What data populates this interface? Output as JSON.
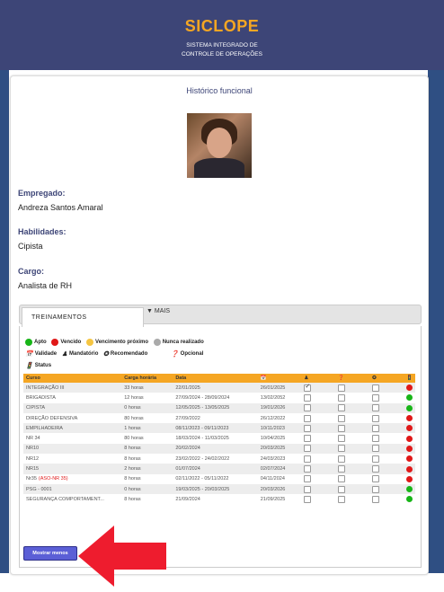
{
  "header": {
    "brand": "SICLOPE",
    "subtitle_line1": "SISTEMA INTEGRADO DE",
    "subtitle_line2": "CONTROLE DE OPERAÇÕES"
  },
  "card": {
    "title": "Histórico funcional"
  },
  "employee": {
    "label": "Empregado:",
    "value": "Andreza Santos Amaral",
    "skills_label": "Habilidades:",
    "skills_value": "Cipista",
    "role_label": "Cargo:",
    "role_value": "Analista de RH"
  },
  "tabs": {
    "active": "TREINAMENTOS",
    "more": "▼ MAIS"
  },
  "legend": {
    "apto": "Apto",
    "vencido": "Vencido",
    "vencimento": "Vencimento próximo",
    "nunca": "Nunca realizado",
    "validade": "Validade",
    "mandatorio": "Mandatório",
    "recomendado": "Recomendado",
    "opcional": "Opcional",
    "status": "Status"
  },
  "table": {
    "headers": [
      "Curso",
      "Carga horária",
      "Data"
    ],
    "rows": [
      {
        "curso": "INTEGRAÇÃO III",
        "carga": "33 horas",
        "data": "22/01/2025",
        "validade": "26/01/2025",
        "mand": true,
        "status": "red"
      },
      {
        "curso": "BRIGADISTA",
        "carga": "12 horas",
        "data": "27/09/2024 - 28/09/2024",
        "validade": "13/02/2052",
        "mand": false,
        "status": "green"
      },
      {
        "curso": "CIPISTA",
        "carga": "0 horas",
        "data": "12/05/2025 - 13/05/2025",
        "validade": "19/01/2026",
        "mand": false,
        "status": "green"
      },
      {
        "curso": "DIREÇÃO DEFENSIVA",
        "carga": "80 horas",
        "data": "27/09/2022",
        "validade": "26/12/2022",
        "mand": false,
        "status": "red"
      },
      {
        "curso": "EMPILHADEIRA",
        "carga": "1 horas",
        "data": "08/11/2023 - 09/11/2023",
        "validade": "10/11/2023",
        "mand": false,
        "status": "red"
      },
      {
        "curso": "NR 34",
        "carga": "80 horas",
        "data": "18/03/2024 - 11/03/2025",
        "validade": "10/04/2025",
        "mand": false,
        "status": "red"
      },
      {
        "curso": "NR10",
        "carga": "8 horas",
        "data": "20/02/2024",
        "validade": "20/03/2025",
        "mand": false,
        "status": "red"
      },
      {
        "curso": "NR12",
        "carga": "8 horas",
        "data": "23/02/2022 - 24/02/2022",
        "validade": "24/03/2023",
        "mand": false,
        "status": "red"
      },
      {
        "curso": "NR15",
        "carga": "2 horas",
        "data": "01/07/2024",
        "validade": "02/07/2024",
        "mand": false,
        "status": "red"
      },
      {
        "curso": "Nr35",
        "curso_extra": "(ASO-NR 35)",
        "carga": "8 horas",
        "data": "02/11/2022 - 05/11/2022",
        "validade": "04/11/2024",
        "mand": false,
        "status": "red"
      },
      {
        "curso": "PSG - 0001",
        "carga": "0 horas",
        "data": "19/03/2025 - 20/03/2025",
        "validade": "20/03/2026",
        "mand": false,
        "status": "green"
      },
      {
        "curso": "SEGURANÇA COMPORTAMENT...",
        "carga": "8 horas",
        "data": "21/09/2024",
        "validade": "21/09/2025",
        "mand": false,
        "status": "green"
      }
    ]
  },
  "button": {
    "label": "Mostrar menos"
  },
  "colors": {
    "header_bg": "#3d4577",
    "brand": "#f5a623",
    "table_header": "#f5a623",
    "green": "#18b518",
    "red": "#e01818",
    "button": "#5b5fd6",
    "arrow": "#ee1c2e"
  }
}
